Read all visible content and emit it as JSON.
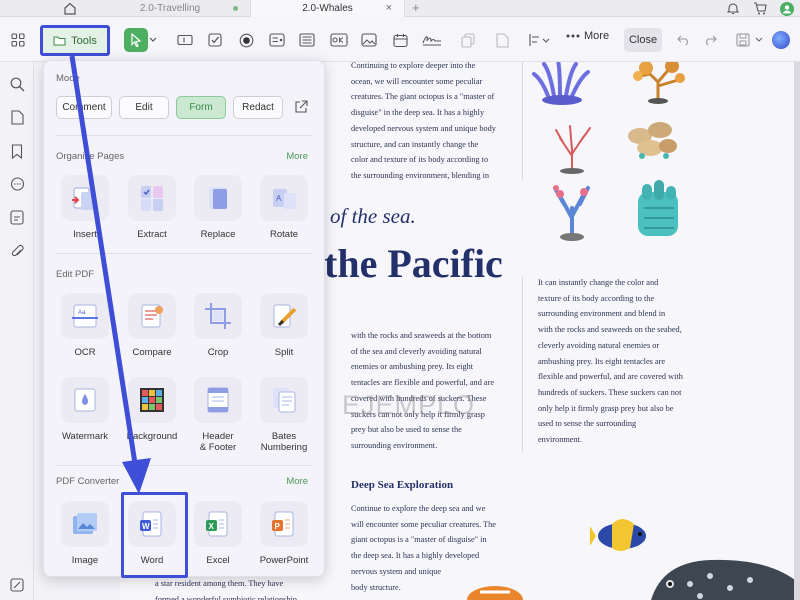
{
  "tabs": [
    {
      "label": "2.0-Travelling",
      "active": false
    },
    {
      "label": "2.0-Whales",
      "active": true
    }
  ],
  "tab_close": "×",
  "tab_add": "+",
  "toolbar": {
    "tools_label": "Tools",
    "more_label": "More",
    "close_label": "Close"
  },
  "panel": {
    "mode": {
      "title": "Mode",
      "buttons": [
        "Comment",
        "Edit",
        "Form",
        "Redact"
      ],
      "active": "Form"
    },
    "organize": {
      "title": "Organize Pages",
      "more": "More",
      "items": [
        "Insert",
        "Extract",
        "Replace",
        "Rotate"
      ]
    },
    "edit_pdf": {
      "title": "Edit PDF",
      "items": [
        "OCR",
        "Compare",
        "Crop",
        "Split",
        "Watermark",
        "Background",
        "Header\n& Footer",
        "Bates\nNumbering"
      ]
    },
    "converter": {
      "title": "PDF Converter",
      "more": "More",
      "items": [
        "Image",
        "Word",
        "Excel",
        "PowerPoint"
      ]
    }
  },
  "document": {
    "col_a": [
      "Continuing to explore deeper into the",
      "ocean, we will encounter some peculiar",
      "creatures. The giant octopus is a \"master of",
      "disguise\" in the deep sea. It has a highly",
      "developed nervous system and unique body",
      "structure, and can instantly change the",
      "color and texture of its body according to",
      "the surrounding environment, blending in"
    ],
    "subline": "of the sea.",
    "title": "the Pacific",
    "col_b": [
      "with the rocks and seaweeds at the bottom",
      "of the sea and cleverly avoiding natural",
      "enemies or ambushing prey. Its eight",
      "tentacles are flexible and powerful, and are",
      "covered with hundreds of suckers. These",
      "suckers can not only help it firmly grasp",
      "prey but also be used to sense the",
      "surrounding environment."
    ],
    "section_heading": "Deep Sea Exploration",
    "col_c": [
      "Continue to explore the deep sea and we",
      "will encounter some peculiar creatures. The",
      "giant octopus is a \"master of disguise\" in",
      "the deep sea. It has a highly developed",
      "nervous system and unique",
      "body structure."
    ],
    "col_d": [
      "It can instantly change the color and",
      "texture of its body according to the",
      "surrounding environment and blend in",
      "with the rocks and seaweeds on the seabed,",
      "cleverly avoiding natural enemies or",
      "ambushing prey. Its eight tentacles are",
      "flexible and powerful, and are covered with",
      "hundreds of suckers. These suckers can not",
      "only help it firmly grasp prey but also be",
      "used to sense the surrounding",
      "environment."
    ],
    "col_e": [
      "a star resident among them. They have",
      "formed a wonderful symbiotic relationship"
    ],
    "watermark": "EJEMPLO"
  },
  "colors": {
    "accent_green": "#4caf62",
    "annotation_blue": "#3f4ed6",
    "title_navy": "#24306a"
  }
}
